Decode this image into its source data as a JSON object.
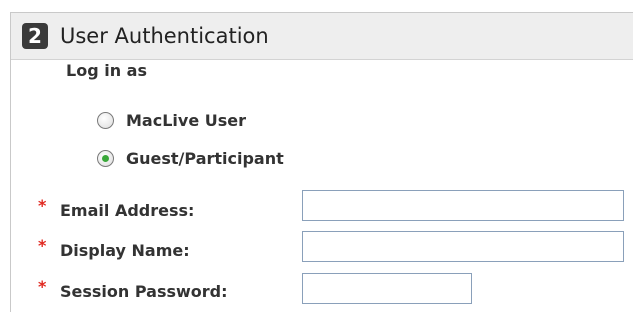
{
  "section": {
    "step_number": "2",
    "title": "User Authentication"
  },
  "login_as": {
    "label": "Log in as",
    "options": [
      {
        "label": "MacLive User",
        "selected": false
      },
      {
        "label": "Guest/Participant",
        "selected": true
      }
    ]
  },
  "fields": {
    "required_marker": "*",
    "email": {
      "label": "Email Address:",
      "value": ""
    },
    "display_name": {
      "label": "Display Name:",
      "value": ""
    },
    "session_password": {
      "label": "Session Password:",
      "value": ""
    }
  },
  "colors": {
    "required_marker": "#e0281f",
    "radio_selected": "#3aa83a",
    "header_background": "#eeeeee",
    "step_badge": "#3a3a3a"
  }
}
